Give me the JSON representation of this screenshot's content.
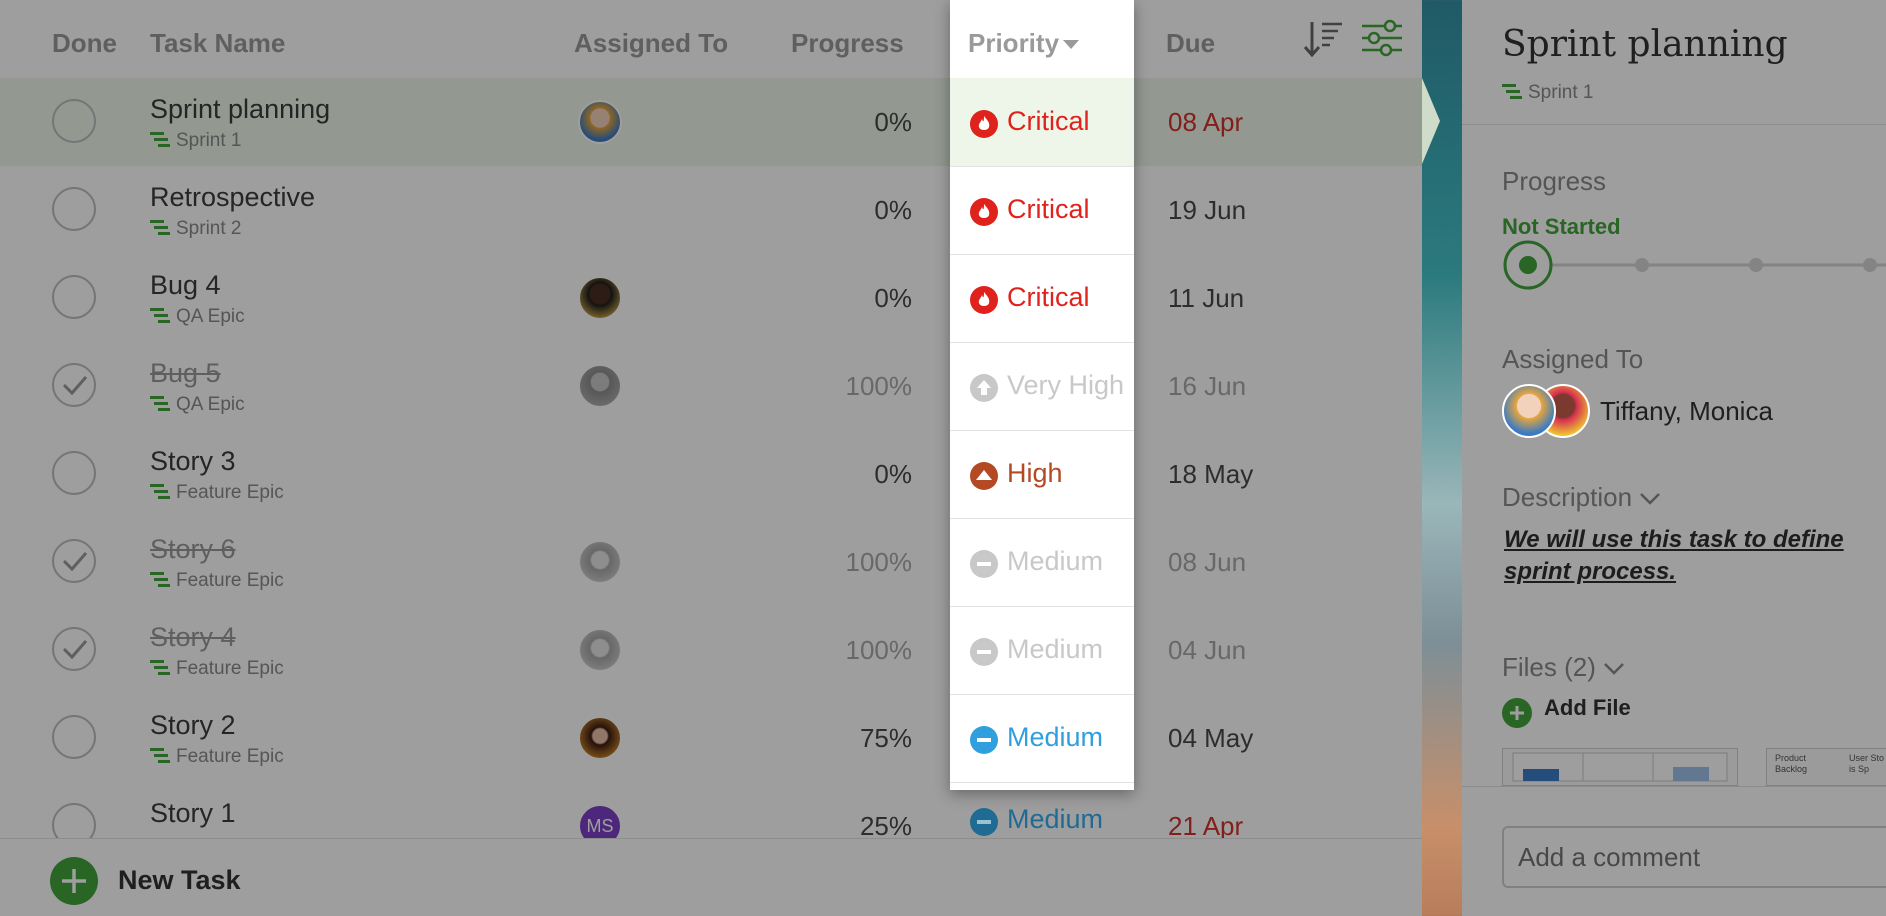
{
  "colors": {
    "brand_green": "#43a33a",
    "critical_red": "#e0221c",
    "high_brown": "#b34a23",
    "medium_blue": "#2f9fdd",
    "muted_gray": "#c8c8c8",
    "overdue_red": "#d0342c"
  },
  "columns": {
    "done": "Done",
    "task_name": "Task Name",
    "assigned_to": "Assigned To",
    "progress": "Progress",
    "priority": "Priority",
    "due": "Due"
  },
  "toolbar": {
    "sort_icon": "sort-lines-icon",
    "filter_icon": "filter-sliders-icon"
  },
  "tasks": [
    {
      "name": "Sprint planning",
      "epic": "Sprint 1",
      "progress": "0%",
      "priority": "Critical",
      "due": "08 Apr",
      "done": false,
      "overdue": true,
      "selected": true
    },
    {
      "name": "Retrospective",
      "epic": "Sprint 2",
      "progress": "0%",
      "priority": "Critical",
      "due": "19 Jun",
      "done": false
    },
    {
      "name": "Bug 4",
      "epic": "QA Epic",
      "progress": "0%",
      "priority": "Critical",
      "due": "11 Jun",
      "done": false
    },
    {
      "name": "Bug 5",
      "epic": "QA Epic",
      "progress": "100%",
      "priority": "Very High",
      "due": "16 Jun",
      "done": true
    },
    {
      "name": "Story 3",
      "epic": "Feature Epic",
      "progress": "0%",
      "priority": "High",
      "due": "18 May",
      "done": false
    },
    {
      "name": "Story 6",
      "epic": "Feature Epic",
      "progress": "100%",
      "priority": "Medium",
      "due": "08 Jun",
      "done": true
    },
    {
      "name": "Story 4",
      "epic": "Feature Epic",
      "progress": "100%",
      "priority": "Medium",
      "due": "04 Jun",
      "done": true
    },
    {
      "name": "Story 2",
      "epic": "Feature Epic",
      "progress": "75%",
      "priority": "Medium",
      "due": "04 May",
      "done": false
    },
    {
      "name": "Story 1",
      "epic": "",
      "progress": "25%",
      "priority": "Medium",
      "due": "21 Apr",
      "done": false,
      "overdue": true,
      "avatar_initials": "MS"
    }
  ],
  "new_task": {
    "label": "New Task"
  },
  "detail": {
    "title": "Sprint planning",
    "epic": "Sprint 1",
    "progress_label": "Progress",
    "status": "Not Started",
    "assigned_label": "Assigned To",
    "assignees": "Tiffany, Monica",
    "description_label": "Description",
    "description": "We will use this task to define sprint process.",
    "files_label": "Files (2)",
    "add_file": "Add File",
    "thumb_text_1": "Product Backlog",
    "thumb_text_2": "User Sto is Sp",
    "comment_placeholder": "Add a comment"
  }
}
